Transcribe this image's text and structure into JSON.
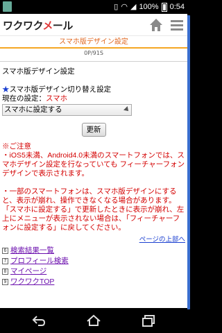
{
  "status": {
    "battery_percent": "100%",
    "time": "0:54"
  },
  "header": {
    "logo_text_1": "ワクワク",
    "logo_text_m": "メ",
    "logo_text_2": "ール",
    "home_icon": "home-icon",
    "menu_icon": "menu-icon"
  },
  "page": {
    "title": "スマホ版デザイン設定",
    "page_number": "0P/91S"
  },
  "section": {
    "title": "スマホ版デザイン設定",
    "switch_label": "スマホ版デザイン切り替え設定",
    "current_label": "現在の設定：",
    "current_value": "スマホ",
    "select_value": "スマホに設定する",
    "update_button": "更新"
  },
  "notice": {
    "heading": "※ご注意",
    "para1": "・iOS5未満、Android4.0未満のスマートフォンでは、スマホデザイン設定を行なっていても フィーチャーフォンデザインで表示されます。",
    "para2": "・一部のスマートフォンは、スマホ版デザインにすると、表示が崩れ、操作できなくなる場合があります。「スマホに設定する」で更新したときに表示が崩れ、左上にメニューが表示されない場合は、「フィーチャーフォンに設定する」に戻してください。"
  },
  "top_link": "ページの上部へ",
  "links": [
    {
      "num": "6",
      "label": "検索結果一覧"
    },
    {
      "num": "7",
      "label": "プロフィール検索"
    },
    {
      "num": "8",
      "label": "マイページ"
    },
    {
      "num": "9",
      "label": "ワクワクTOP"
    }
  ]
}
